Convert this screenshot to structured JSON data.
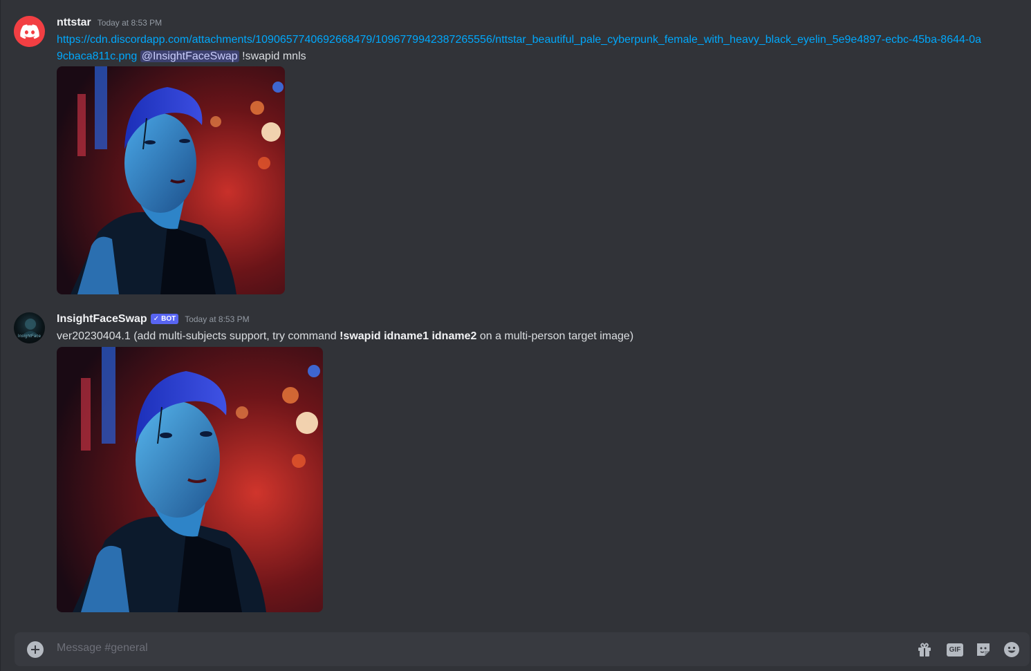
{
  "channel": {
    "composer_placeholder": "Message #general"
  },
  "messages": [
    {
      "username": "nttstar",
      "timestamp": "Today at 8:53 PM",
      "link_text": "https://cdn.discordapp.com/attachments/1090657740692668479/1096779942387265556/nttstar_beautiful_pale_cyberpunk_female_with_heavy_black_eyelin_5e9e4897-ecbc-45ba-8644-0a9cbaca811c.png",
      "mention": "@InsightFaceSwap",
      "command_text": "!swapid mnls",
      "avatar_icon": "discord-logo-icon"
    },
    {
      "username": "InsightFaceSwap",
      "badge_check": "✓",
      "badge": "BOT",
      "timestamp": "Today at 8:53 PM",
      "text_prefix": "ver20230404.1 (add multi-subjects support, try command ",
      "text_command": "!swapid idname1 idname2",
      "text_suffix": " on a multi-person target image)",
      "avatar_label": "InsightFace"
    }
  ],
  "composer_tools": {
    "add_icon": "plus-circle-icon",
    "gift_icon": "gift-icon",
    "gif_label": "GIF",
    "sticker_icon": "sticker-icon",
    "emoji_icon": "emoji-icon"
  },
  "colors": {
    "background": "#313338",
    "link": "#00a8fc",
    "bot_badge": "#5865f2",
    "discord_red": "#f23f43"
  }
}
